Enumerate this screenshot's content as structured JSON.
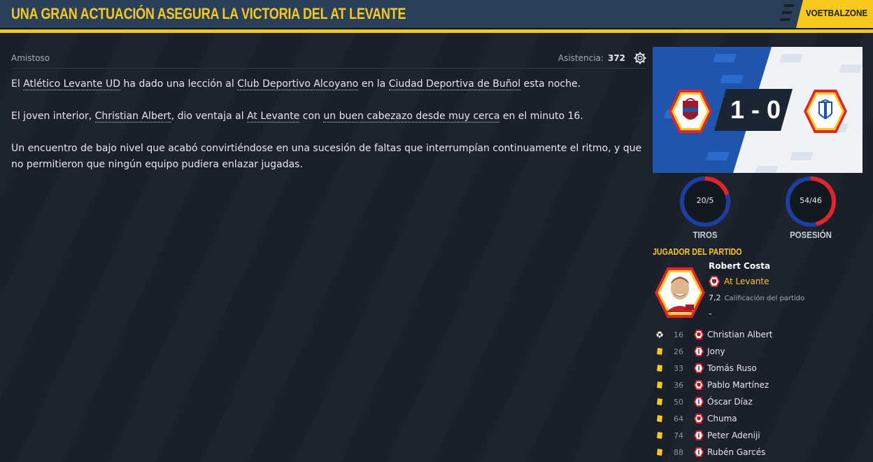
{
  "header": {
    "title": "UNA GRAN ACTUACIÓN ASEGURA LA VICTORIA DEL AT LEVANTE",
    "brand": "VOETBALZONE"
  },
  "meta": {
    "competition": "Amistoso",
    "attendance_label": "Asistencia:",
    "attendance_value": "372"
  },
  "article": {
    "p1": {
      "t1": "El ",
      "l1": "Atlético Levante UD",
      "t2": " ha dado una lección al ",
      "l2": "Club Deportivo Alcoyano",
      "t3": " en la ",
      "l3": "Ciudad Deportiva de Buñol",
      "t4": " esta noche."
    },
    "p2": {
      "t1": "El joven interior, ",
      "l1": "Christian Albert",
      "t2": ", dio ventaja al ",
      "l2": "At Levante",
      "t3": " con ",
      "l3": "un buen cabezazo desde muy cerca",
      "t4": " en el minuto 16."
    },
    "p3": "Un encuentro de bajo nivel que acabó convirtiéndose en una sucesión de faltas que interrumpían continuamente el ritmo, y que no permitieron que ningún equipo pudiera enlazar jugadas."
  },
  "score": {
    "text": "1 - 0",
    "home_color": "#1f4fa3",
    "away_color": "#e0252c"
  },
  "stats": {
    "shots": {
      "value": "20/5",
      "label": "TIROS",
      "home_fraction": 0.8
    },
    "possession": {
      "value": "54/46",
      "label": "POSESIÓN",
      "home_fraction": 0.54
    }
  },
  "motm": {
    "title": "JUGADOR DEL PARTIDO",
    "name": "Robert Costa",
    "team": "At Levante",
    "rating": "7,2",
    "rating_label": "Calificación del partido",
    "extra": "-"
  },
  "events": [
    {
      "type": "goal",
      "minute": "16",
      "player": "Christian Albert",
      "team": "home"
    },
    {
      "type": "yellow",
      "minute": "26",
      "player": "Jony",
      "team": "away"
    },
    {
      "type": "yellow",
      "minute": "33",
      "player": "Tomás Ruso",
      "team": "away"
    },
    {
      "type": "yellow",
      "minute": "36",
      "player": "Pablo Martínez",
      "team": "home"
    },
    {
      "type": "yellow",
      "minute": "50",
      "player": "Óscar Díaz",
      "team": "away"
    },
    {
      "type": "yellow",
      "minute": "64",
      "player": "Chuma",
      "team": "home"
    },
    {
      "type": "yellow",
      "minute": "74",
      "player": "Peter Adeniji",
      "team": "away"
    },
    {
      "type": "yellow",
      "minute": "88",
      "player": "Rubén Garcés",
      "team": "away"
    }
  ]
}
